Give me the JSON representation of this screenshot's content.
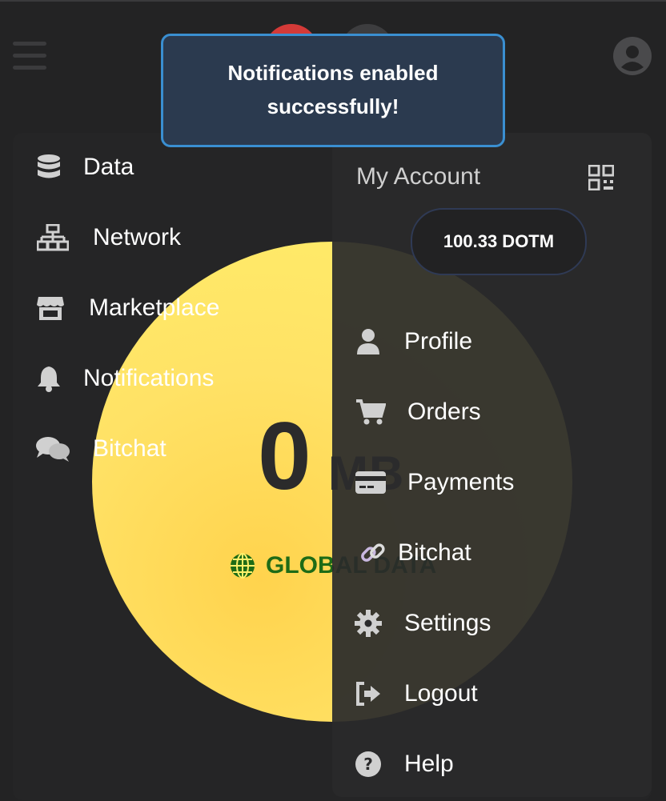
{
  "toast": {
    "line1": "Notifications enabled",
    "line2": "successfully!"
  },
  "sidebar": {
    "items": [
      {
        "label": "Data",
        "icon": "database-icon"
      },
      {
        "label": "Network",
        "icon": "network-icon"
      },
      {
        "label": "Marketplace",
        "icon": "store-icon"
      },
      {
        "label": "Notifications",
        "icon": "bell-icon"
      },
      {
        "label": "Bitchat",
        "icon": "chat-icon"
      }
    ]
  },
  "usage": {
    "value": "0",
    "unit": "MB",
    "scope_label": "GLOBAL DATA"
  },
  "account": {
    "title": "My Account",
    "balance": "100.33 DOTM",
    "menu": [
      {
        "label": "Profile",
        "icon": "user-icon"
      },
      {
        "label": "Orders",
        "icon": "cart-icon"
      },
      {
        "label": "Payments",
        "icon": "credit-card-icon"
      },
      {
        "label": "Bitchat",
        "icon": "link-icon"
      },
      {
        "label": "Settings",
        "icon": "gear-icon"
      },
      {
        "label": "Logout",
        "icon": "logout-icon"
      },
      {
        "label": "Help",
        "icon": "help-icon"
      }
    ]
  },
  "colors": {
    "accent_toast_border": "#3a8fd1",
    "disc_yellow": "#ffe266",
    "global_green": "#1e6b16",
    "status_red": "#d43a38"
  }
}
